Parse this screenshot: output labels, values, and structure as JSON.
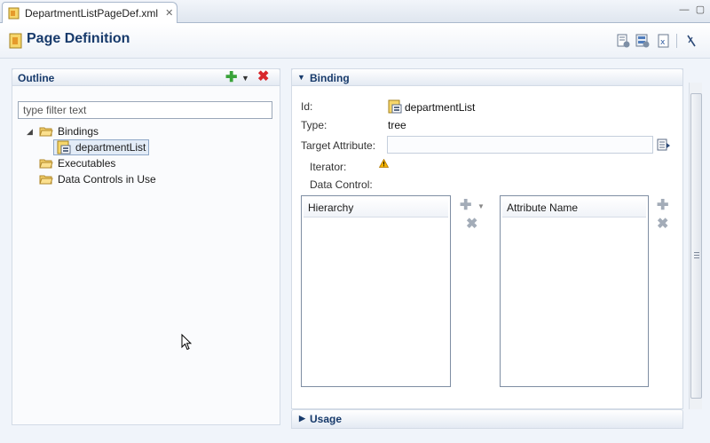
{
  "editor_tab": {
    "label": "DepartmentListPageDef.xml"
  },
  "header": {
    "title": "Page Definition"
  },
  "outline": {
    "title": "Outline",
    "filter_placeholder": "type filter text",
    "tree": {
      "bindings": "Bindings",
      "department_list": "departmentList",
      "executables": "Executables",
      "data_controls": "Data Controls in Use"
    }
  },
  "binding": {
    "title": "Binding",
    "id_label": "Id:",
    "id_value": "departmentList",
    "type_label": "Type:",
    "type_value": "tree",
    "target_attribute_label": "Target Attribute:",
    "target_attribute_value": "",
    "iterator_label": "Iterator:",
    "data_control_label": "Data Control:",
    "hierarchy_header": "Hierarchy",
    "attribute_name_header": "Attribute Name"
  },
  "usage": {
    "title": "Usage"
  },
  "colors": {
    "title_blue": "#173a6b",
    "add_green": "#3aa33a",
    "delete_red": "#d8262b",
    "warning": "#e8a000"
  },
  "icons": [
    "page-def-icon",
    "close-icon",
    "add-icon",
    "dropdown-icon",
    "delete-icon",
    "folder-icon",
    "binding-icon",
    "warning-icon",
    "browse-icon"
  ]
}
